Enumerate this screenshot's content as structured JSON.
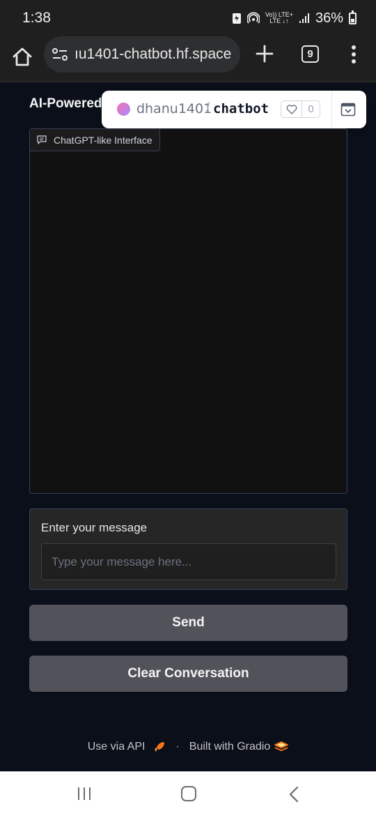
{
  "status_bar": {
    "time": "1:38",
    "network_top": "Vo)) LTE+",
    "network_bottom": "LTE ↓↑",
    "battery": "36%"
  },
  "browser": {
    "url": "ıu1401-chatbot.hf.space",
    "tab_count": "9"
  },
  "page": {
    "title": "AI-Powered"
  },
  "hf_overlay": {
    "user": "dhanu1401",
    "separator": "/",
    "repo": "chatbot",
    "likes": "0"
  },
  "chatbot": {
    "label": "ChatGPT-like Interface"
  },
  "message_input": {
    "label": "Enter your message",
    "placeholder": "Type your message here...",
    "value": ""
  },
  "buttons": {
    "send": "Send",
    "clear": "Clear Conversation"
  },
  "footer": {
    "api_link": "Use via API",
    "separator": "·",
    "built_with": "Built with Gradio"
  },
  "colors": {
    "background": "#0b0f19",
    "button": "#52525b",
    "panel_border": "#374151",
    "gradio_orange": "#f97316"
  }
}
